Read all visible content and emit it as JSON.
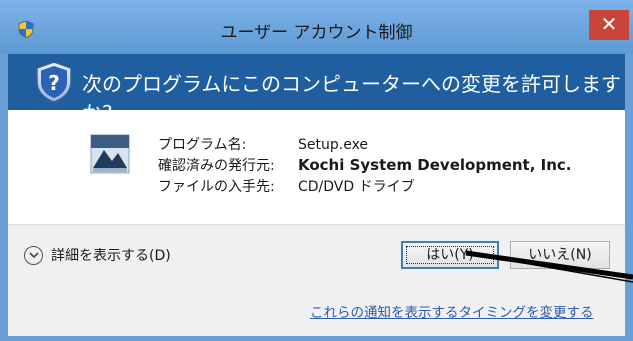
{
  "title_bar": {
    "title": "ユーザー アカウント制御",
    "close_glyph": "✕",
    "shield_icon": "uac-shield-icon",
    "close_color": "#c9453a"
  },
  "banner": {
    "question": "次のプログラムにこのコンピューターへの変更を許可しますか?",
    "icon": "question-shield-icon",
    "background": "#1f5fa0"
  },
  "program_info": {
    "app_icon": "setup-app-icon",
    "rows": [
      {
        "label": "プログラム名:",
        "value": "Setup.exe",
        "bold": false
      },
      {
        "label": "確認済みの発行元:",
        "value": "Kochi System Development, Inc.",
        "bold": true
      },
      {
        "label": "ファイルの入手先:",
        "value": "CD/DVD ドライブ",
        "bold": false
      }
    ]
  },
  "footer": {
    "details_label": "詳細を表示する(D)",
    "yes_label": "はい(Y)",
    "no_label": "いいえ(N)",
    "settings_link": "これらの通知を表示するタイミングを変更する"
  }
}
